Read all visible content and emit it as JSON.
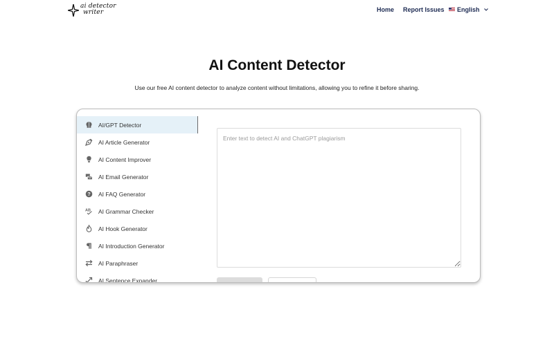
{
  "header": {
    "logo_line1": "ai detector",
    "logo_line2": "writer",
    "nav": [
      {
        "label": "Home"
      },
      {
        "label": "Report Issues"
      }
    ],
    "language": {
      "label": "English",
      "icon": "us-flag-icon"
    }
  },
  "hero": {
    "title": "AI Content Detector",
    "subtitle": "Use our free AI content detector to analyze content without limitations, allowing you to refine it before sharing."
  },
  "sidebar": {
    "items": [
      {
        "label": "AI/GPT Detector",
        "icon": "brain-icon",
        "active": true
      },
      {
        "label": "AI Article Generator",
        "icon": "pen-nib-icon"
      },
      {
        "label": "AI Content Improver",
        "icon": "lightbulb-icon"
      },
      {
        "label": "AI Email Generator",
        "icon": "mail-bulk-icon"
      },
      {
        "label": "AI FAQ Generator",
        "icon": "question-circle-icon"
      },
      {
        "label": "AI Grammar Checker",
        "icon": "spell-check-icon"
      },
      {
        "label": "AI Hook Generator",
        "icon": "fire-icon"
      },
      {
        "label": "AI Introduction Generator",
        "icon": "paragraph-icon"
      },
      {
        "label": "AI Paraphraser",
        "icon": "exchange-arrows-icon"
      },
      {
        "label": "AI Sentence Expander",
        "icon": "expand-icon"
      }
    ]
  },
  "editor": {
    "placeholder": "Enter text to detect AI and ChatGPT plagiarism",
    "value": ""
  },
  "colors": {
    "nav_text": "#1c2a52",
    "active_item_bg": "#e5f1f8",
    "primary_button_bg": "#dcdcdc"
  }
}
